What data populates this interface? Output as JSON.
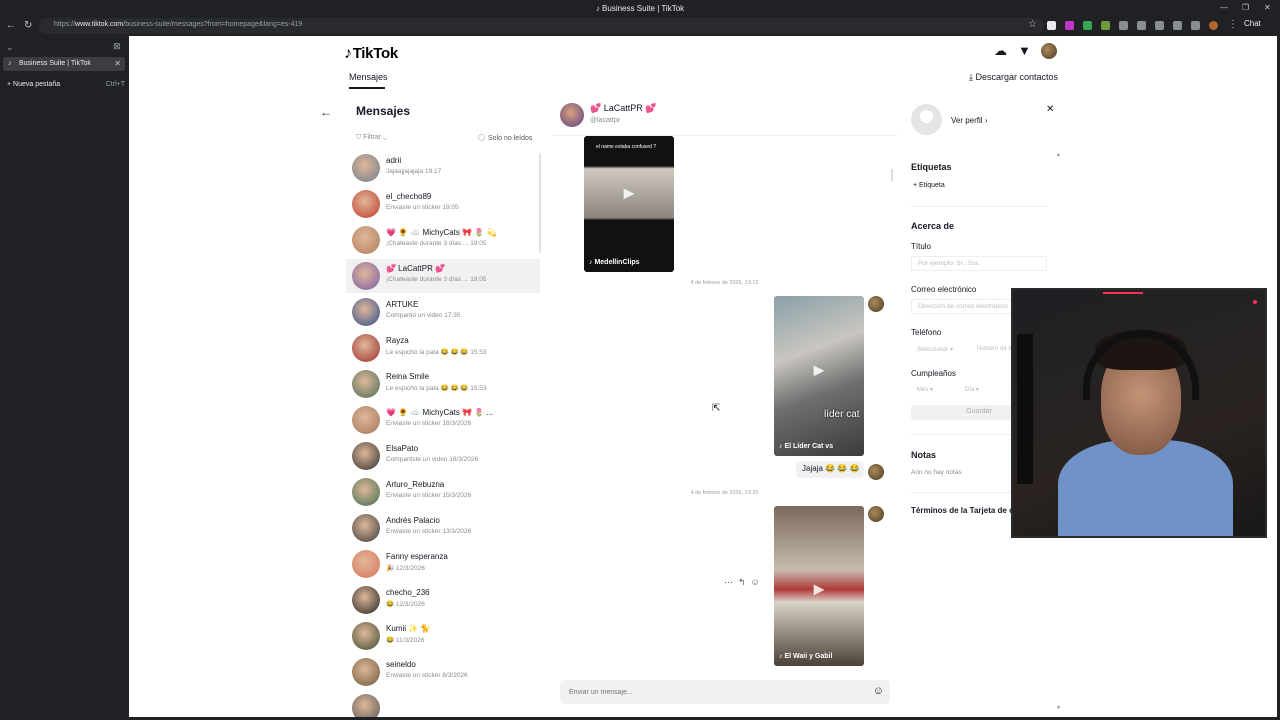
{
  "browser": {
    "title": "Business Suite | TikTok",
    "url_prefix": "https://",
    "url_host": "www.tiktok.com",
    "url_rest": "/business-suite/messages?from=homepage&lang=es-419",
    "chat_label": "Chat"
  },
  "vertical_tabs": {
    "active_tab": "Business Suite | TikTok",
    "new_tab": "Nueva pestaña",
    "new_tab_shortcut": "Ctrl+T"
  },
  "header": {
    "logo": "TikTok",
    "tab_messages": "Mensajes",
    "download_contacts": "Descargar contactos"
  },
  "conversations": {
    "title": "Mensajes",
    "filter_label": "Filtrar",
    "unread_only": "Solo no leídos",
    "items": [
      {
        "name": "adrii",
        "preview": "Jajaajjajajaja 19:17",
        "color": "#6e7c8a"
      },
      {
        "name": "el_checho89",
        "preview": "Enviaste un sticker 19:05",
        "color": "#c0392b"
      },
      {
        "name": "💗 🌻 ☁️ MichyCats 🎀 🌷 💫",
        "preview": "¡Chateaste durante 3 días ... 19:05",
        "color": "#b07d5a"
      },
      {
        "name": "💕 LaCattPR 💕",
        "preview": "¡Chateaste durante 3 días ... 19:05",
        "color": "#7b5aa6"
      },
      {
        "name": "ARTUKE",
        "preview": "Compartió un video 17:35",
        "color": "#2c4d8a"
      },
      {
        "name": "Rayza",
        "preview": "Le espichó la pata 😂 😂 😂 15:53",
        "color": "#9b2d2d"
      },
      {
        "name": "Reina Smile",
        "preview": "Le espichó la pata 😂 😂 😂 15:53",
        "color": "#4a6d55"
      },
      {
        "name": "💗 🌻 ☁️ MichyCats 🎀 🌷 ...",
        "preview": "Enviaste un sticker 18/3/2026",
        "color": "#a3765a"
      },
      {
        "name": "ElsaPato",
        "preview": "Compartiste un video 16/3/2026",
        "color": "#2e2e2e"
      },
      {
        "name": "Arturo_Rebuzna",
        "preview": "Enviaste un sticker 15/3/2026",
        "color": "#3c6e4c"
      },
      {
        "name": "Andrés Palacio",
        "preview": "Enviaste un sticker 13/3/2026",
        "color": "#3a3a3a"
      },
      {
        "name": "Fanny esperanza",
        "preview": "🎉 12/3/2026",
        "color": "#d9745a"
      },
      {
        "name": "checho_236",
        "preview": "😂 12/3/2026",
        "color": "#222222"
      },
      {
        "name": "Kumii ✨ 🐈",
        "preview": "😂 11/3/2026",
        "color": "#3d4a2e"
      },
      {
        "name": "seineldo",
        "preview": "Enviaste un sticker 8/3/2026",
        "color": "#6b5a3a"
      },
      {
        "name": "",
        "preview": "",
        "color": "#555555"
      }
    ]
  },
  "chat": {
    "name": "💕 LaCattPR 💕",
    "handle": "@lacattpr",
    "video1_caption": "MedellinClips",
    "video1_top_text": "el name estaba confused ?",
    "date1": "4 de febrero de 2026, 13:12",
    "video2_caption": "El Líder Cat vs",
    "video2_overlay": "líder cat",
    "bubble_text": "Jajaja 😂 😂 😂",
    "date2": "4 de febrero de 2026, 13:25",
    "video3_caption": "El Waii y Gabil",
    "composer_placeholder": "Enviar un mensaje..."
  },
  "profile": {
    "view_profile": "Ver perfil",
    "labels_title": "Etiquetas",
    "add_label": "+ Etiqueta",
    "about_title": "Acerca de",
    "title_label": "Título",
    "title_placeholder": "Por ejemplo: Sr., Sra.",
    "email_label": "Correo electrónico",
    "email_placeholder": "Dirección de correo electrónico",
    "phone_label": "Teléfono",
    "phone_select": "Seleccionar ▾",
    "phone_placeholder": "Número de teléfono",
    "birthday_label": "Cumpleaños",
    "month_select": "Mes ▾",
    "day_select": "Día ▾",
    "save_button": "Guardar",
    "notes_title": "Notas",
    "no_notes": "Aún no hay notas",
    "terms": "Términos de la Tarjeta de contacto"
  },
  "colors": {
    "accent": "#fe2c55",
    "text": "#161823",
    "muted": "#8a8b91",
    "chrome": "#202124"
  }
}
